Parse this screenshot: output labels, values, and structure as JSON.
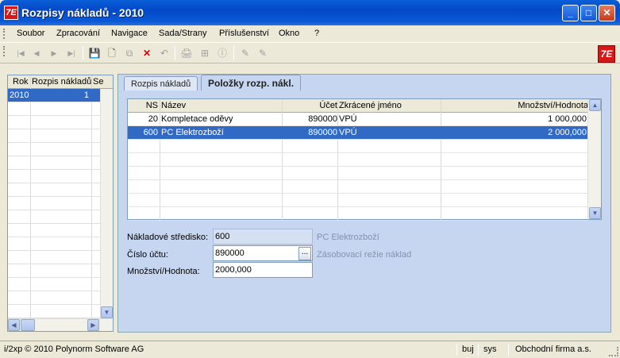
{
  "window": {
    "title": "Rozpisy nákladů - 2010",
    "icon_label": "7E",
    "min": "_",
    "max": "□",
    "close": "✕"
  },
  "menu": [
    "Soubor",
    "Zpracování",
    "Navigace",
    "Sada/Strany",
    "Příslušenství",
    "Okno",
    "?"
  ],
  "toolbar": {
    "first": "|◀",
    "prev": "◀",
    "next": "▶",
    "last": "▶|",
    "save": "💾",
    "new": "🗋",
    "copy": "⧉",
    "delete": "✕",
    "undo": "↶",
    "print": "🖨",
    "tree": "⊞",
    "info": "ⓘ",
    "edit": "✎",
    "edit2": "✎",
    "brand": "7E"
  },
  "left_grid": {
    "headers": [
      "Rok",
      "Rozpis nákladů",
      "Se"
    ],
    "rows": [
      {
        "rok": "2010",
        "rozpis": "1"
      }
    ],
    "left_arrow": "◀",
    "right_arrow": "▶",
    "down_arrow": "▼"
  },
  "tabs": [
    "Rozpis nákladů",
    "Položky rozp. nákl."
  ],
  "items_grid": {
    "headers": {
      "ns": "NS",
      "nazev": "Název",
      "ucet": "Účet",
      "zkratka": "Zkrácené jméno",
      "mnozstvi": "Množství/Hodnota"
    },
    "rows": [
      {
        "ns": "20",
        "nazev": "Kompletace oděvy",
        "ucet": "890000",
        "zkratka": "VPÚ",
        "mnozstvi": "1 000,000"
      },
      {
        "ns": "600",
        "nazev": "PC Elektrozboží",
        "ucet": "890000",
        "zkratka": "VPÚ",
        "mnozstvi": "2 000,000"
      }
    ],
    "up_arrow": "▲",
    "down_arrow": "▼"
  },
  "form": {
    "stredisko_label": "Nákladové středisko:",
    "stredisko_value": "600",
    "stredisko_desc": "PC Elektrozboží",
    "ucet_label": "Číslo účtu:",
    "ucet_value": "890000",
    "ucet_btn": "...",
    "ucet_desc": "Zásobovací režie náklad",
    "mnozstvi_label": "Množství/Hodnota:",
    "mnozstvi_value": "2000,000"
  },
  "status": {
    "copyright": "i/2xp © 2010 Polynorm Software AG",
    "user": "buj",
    "db": "sys",
    "company": "Obchodní firma a.s."
  }
}
